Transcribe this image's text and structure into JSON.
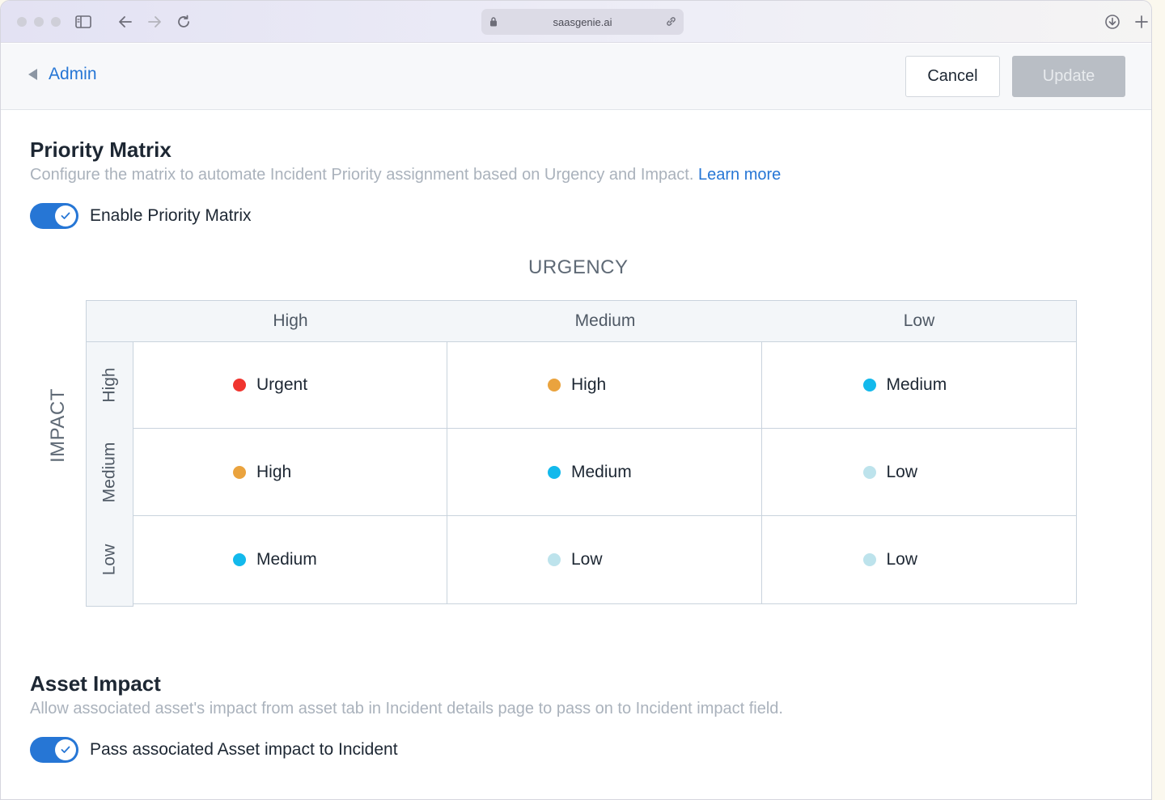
{
  "browser": {
    "url": "saasgenie.ai"
  },
  "header": {
    "back_label": "Admin",
    "cancel_label": "Cancel",
    "update_label": "Update"
  },
  "priority_matrix": {
    "title": "Priority Matrix",
    "description": "Configure the matrix to automate Incident Priority assignment based on Urgency and Impact.",
    "learn_more": "Learn more",
    "toggle_label": "Enable Priority Matrix",
    "toggle_on": true,
    "urgency_axis": "URGENCY",
    "impact_axis": "IMPACT",
    "urgency_levels": [
      "High",
      "Medium",
      "Low"
    ],
    "impact_levels": [
      "High",
      "Medium",
      "Low"
    ],
    "rows": [
      [
        {
          "label": "Urgent",
          "color": "#f0352f"
        },
        {
          "label": "High",
          "color": "#eaa33e"
        },
        {
          "label": "Medium",
          "color": "#13b9ec"
        }
      ],
      [
        {
          "label": "High",
          "color": "#eaa33e"
        },
        {
          "label": "Medium",
          "color": "#13b9ec"
        },
        {
          "label": "Low",
          "color": "#bde3ec"
        }
      ],
      [
        {
          "label": "Medium",
          "color": "#13b9ec"
        },
        {
          "label": "Low",
          "color": "#bde3ec"
        },
        {
          "label": "Low",
          "color": "#bde3ec"
        }
      ]
    ]
  },
  "asset_impact": {
    "title": "Asset Impact",
    "description": "Allow associated asset's impact from asset tab in Incident details page to pass on to Incident impact field.",
    "toggle_label": "Pass associated Asset impact to Incident",
    "toggle_on": true
  },
  "colors": {
    "accent": "#2676d5",
    "urgent": "#f0352f",
    "high": "#eaa33e",
    "medium": "#13b9ec",
    "low": "#bde3ec"
  }
}
